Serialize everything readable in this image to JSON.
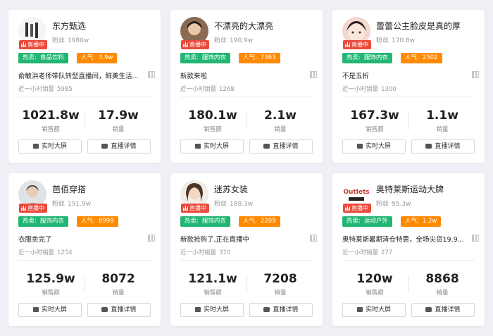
{
  "labels": {
    "live": "直播中",
    "fans": "粉丝",
    "hot": "热卖:",
    "popularity": "人气:",
    "hour_sales": "近一小时销量",
    "sales_amount": "销售额",
    "sales_volume": "销量",
    "realtime_btn": "实时大屏",
    "detail_btn": "直播详情"
  },
  "cards": [
    {
      "name": "东方甄选",
      "fans": "1980w",
      "category": "食品饮料",
      "popularity": "3.9w",
      "desc": "俞敏洪老师带队转型直播间，鲜美生活...",
      "hour_sales": "5985",
      "amount": "1021.8w",
      "volume": "17.9w"
    },
    {
      "name": "不漂亮的大漂亮",
      "fans": "190.9w",
      "category": "服饰内衣",
      "popularity": "7363",
      "desc": "新款来啦",
      "hour_sales": "1268",
      "amount": "180.1w",
      "volume": "2.1w"
    },
    {
      "name": "蕾蕾公主脸皮是真的厚",
      "fans": "170.8w",
      "category": "服饰内衣",
      "popularity": "2502",
      "desc": "不是五折",
      "hour_sales": "1300",
      "amount": "167.3w",
      "volume": "1.1w"
    },
    {
      "name": "芭佰穿搭",
      "fans": "191.9w",
      "category": "服饰内衣",
      "popularity": "8999",
      "desc": "衣服卖完了",
      "hour_sales": "1254",
      "amount": "125.9w",
      "volume": "8072"
    },
    {
      "name": "迷苏女装",
      "fans": "188.3w",
      "category": "服饰内衣",
      "popularity": "2209",
      "desc": "新款抢购了,正在直播中",
      "hour_sales": "370",
      "amount": "121.1w",
      "volume": "7208"
    },
    {
      "name": "奥特莱斯运动大牌",
      "fans": "95.3w",
      "category": "运动户外",
      "popularity": "1.2w",
      "desc": "奥特莱斯暑期清仓特惠，全场尖货19.9...",
      "hour_sales": "277",
      "amount": "120w",
      "volume": "8868",
      "logo_text": "Outlets"
    }
  ]
}
